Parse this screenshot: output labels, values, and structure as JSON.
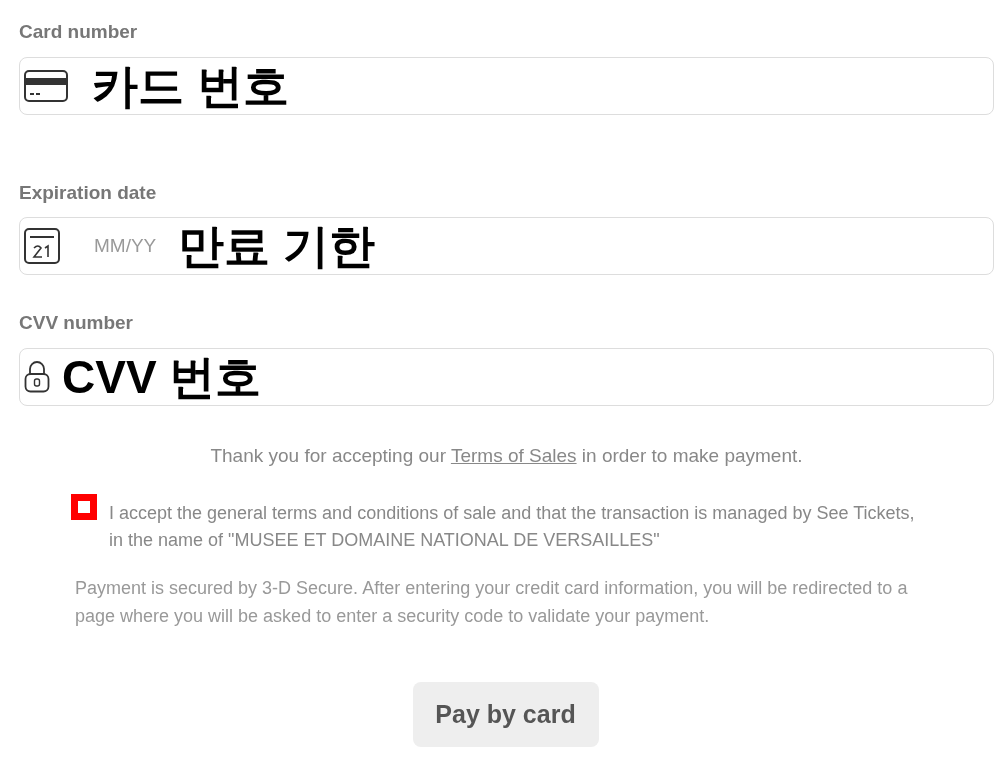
{
  "fields": [
    {
      "label": "Card number",
      "kind": "card",
      "annotation": "카드 번호"
    },
    {
      "label": "Expiration date",
      "kind": "date",
      "placeholder": "MM/YY",
      "annotation": "만료 기한"
    },
    {
      "label": "CVV number",
      "kind": "cvv",
      "annotation": "CVV 번호"
    }
  ],
  "notice": {
    "before": "Thank you for accepting our ",
    "link": "Terms of Sales",
    "after": " in order to make payment."
  },
  "terms_checkbox": {
    "checked": false,
    "label": "I accept the general terms and conditions of sale and that the transaction is managed by See Tickets, in the name of \"MUSEE ET DOMAINE NATIONAL DE VERSAILLES\""
  },
  "security_note": "Payment is secured by 3-D Secure. After entering your credit card information, you will be redirected to a page where you will be asked to enter a security code to validate your payment.",
  "pay_button": "Pay by card"
}
